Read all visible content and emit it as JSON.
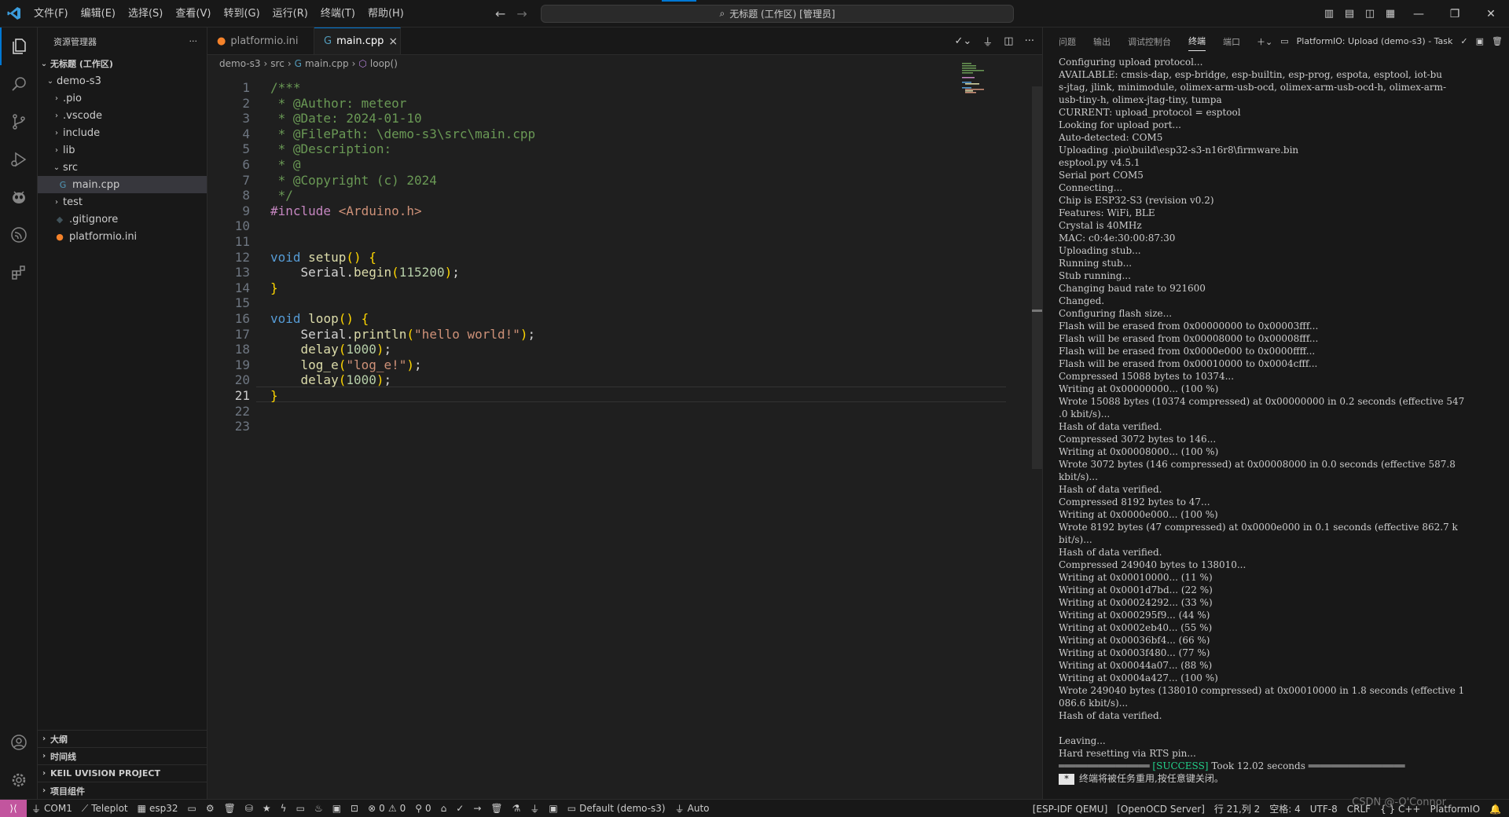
{
  "titlebar": {
    "menus": [
      "文件(F)",
      "编辑(E)",
      "选择(S)",
      "查看(V)",
      "转到(G)",
      "运行(R)",
      "终端(T)",
      "帮助(H)"
    ],
    "search_text": "无标题 (工作区) [管理员]"
  },
  "sidebar": {
    "title": "资源管理器",
    "more": "···",
    "workspace": "无标题 (工作区)",
    "project": "demo-s3",
    "items": [
      {
        "label": ".pio",
        "type": "folder"
      },
      {
        "label": ".vscode",
        "type": "folder"
      },
      {
        "label": "include",
        "type": "folder"
      },
      {
        "label": "lib",
        "type": "folder"
      },
      {
        "label": "src",
        "type": "folder-open"
      },
      {
        "label": "main.cpp",
        "type": "file-cpp"
      },
      {
        "label": "test",
        "type": "folder"
      },
      {
        "label": ".gitignore",
        "type": "file-git"
      },
      {
        "label": "platformio.ini",
        "type": "file-pio"
      }
    ],
    "sections": [
      "大纲",
      "时间线",
      "KEIL UVISION PROJECT",
      "项目组件"
    ]
  },
  "editor": {
    "tabs": [
      {
        "label": "platformio.ini",
        "active": false
      },
      {
        "label": "main.cpp",
        "active": true
      }
    ],
    "close_glyph": "×",
    "breadcrumbs": [
      "demo-s3",
      "src",
      "main.cpp",
      "loop()"
    ],
    "code": [
      "/***",
      " * @Author: meteor",
      " * @Date: 2024-01-10",
      " * @FilePath: \\demo-s3\\src\\main.cpp",
      " * @Description:",
      " * @",
      " * @Copyright (c) 2024",
      " */",
      "#include <Arduino.h>",
      "",
      "",
      "void setup() {",
      "    Serial.begin(115200);",
      "}",
      "",
      "void loop() {",
      "    Serial.println(\"hello world!\");",
      "    delay(1000);",
      "    log_e(\"log_e!\");",
      "    delay(1000);",
      "}",
      "",
      ""
    ],
    "current_line": 21
  },
  "panel": {
    "tabs": [
      "问题",
      "输出",
      "调试控制台",
      "终端",
      "端口"
    ],
    "active_tab": "终端",
    "task_label": "PlatformIO: Upload (demo-s3) - Task",
    "terminal_lines": [
      "Configuring upload protocol...",
      "AVAILABLE: cmsis-dap, esp-bridge, esp-builtin, esp-prog, espota, esptool, iot-bu",
      "s-jtag, jlink, minimodule, olimex-arm-usb-ocd, olimex-arm-usb-ocd-h, olimex-arm-",
      "usb-tiny-h, olimex-jtag-tiny, tumpa",
      "CURRENT: upload_protocol = esptool",
      "Looking for upload port...",
      "Auto-detected: COM5",
      "Uploading .pio\\build\\esp32-s3-n16r8\\firmware.bin",
      "esptool.py v4.5.1",
      "Serial port COM5",
      "Connecting...",
      "Chip is ESP32-S3 (revision v0.2)",
      "Features: WiFi, BLE",
      "Crystal is 40MHz",
      "MAC: c0:4e:30:00:87:30",
      "Uploading stub...",
      "Running stub...",
      "Stub running...",
      "Changing baud rate to 921600",
      "Changed.",
      "Configuring flash size...",
      "Flash will be erased from 0x00000000 to 0x00003fff...",
      "Flash will be erased from 0x00008000 to 0x00008fff...",
      "Flash will be erased from 0x0000e000 to 0x0000ffff...",
      "Flash will be erased from 0x00010000 to 0x0004cfff...",
      "Compressed 15088 bytes to 10374...",
      "Writing at 0x00000000... (100 %)",
      "Wrote 15088 bytes (10374 compressed) at 0x00000000 in 0.2 seconds (effective 547",
      ".0 kbit/s)...",
      "Hash of data verified.",
      "Compressed 3072 bytes to 146...",
      "Writing at 0x00008000... (100 %)",
      "Wrote 3072 bytes (146 compressed) at 0x00008000 in 0.0 seconds (effective 587.8",
      "kbit/s)...",
      "Hash of data verified.",
      "Compressed 8192 bytes to 47...",
      "Writing at 0x0000e000... (100 %)",
      "Wrote 8192 bytes (47 compressed) at 0x0000e000 in 0.1 seconds (effective 862.7 k",
      "bit/s)...",
      "Hash of data verified.",
      "Compressed 249040 bytes to 138010...",
      "Writing at 0x00010000... (11 %)",
      "Writing at 0x0001d7bd... (22 %)",
      "Writing at 0x00024292... (33 %)",
      "Writing at 0x000295f9... (44 %)",
      "Writing at 0x0002eb40... (55 %)",
      "Writing at 0x00036bf4... (66 %)",
      "Writing at 0x0003f480... (77 %)",
      "Writing at 0x00044a07... (88 %)",
      "Writing at 0x0004a427... (100 %)",
      "Wrote 249040 bytes (138010 compressed) at 0x00010000 in 1.8 seconds (effective 1",
      "086.6 kbit/s)...",
      "Hash of data verified.",
      "",
      "Leaving...",
      "Hard resetting via RTS pin..."
    ],
    "success_tag": "[SUCCESS]",
    "success_text": "Took 12.02 seconds",
    "cursor_glyph": "*",
    "reuse_text": "终端将被任务重用,按任意键关闭。"
  },
  "statusbar": {
    "left": [
      {
        "icon": "plug-icon",
        "label": "COM1"
      },
      {
        "icon": "chart-icon",
        "label": "Teleplot"
      },
      {
        "icon": "chip-icon",
        "label": "esp32"
      }
    ],
    "errors": "0",
    "warnings": "0",
    "ports": "0",
    "env": "Default (demo-s3)",
    "auto": "Auto",
    "right": [
      "[ESP-IDF QEMU]",
      "[OpenOCD Server]",
      "行 21,列 2",
      "空格: 4",
      "UTF-8",
      "CRLF",
      "{ } C++",
      "PlatformIO"
    ]
  },
  "watermark": "CSDN @-O'Connor",
  "colors": {
    "accent": "#0078d4",
    "success": "#23d18b",
    "remote": "#c2559e"
  }
}
